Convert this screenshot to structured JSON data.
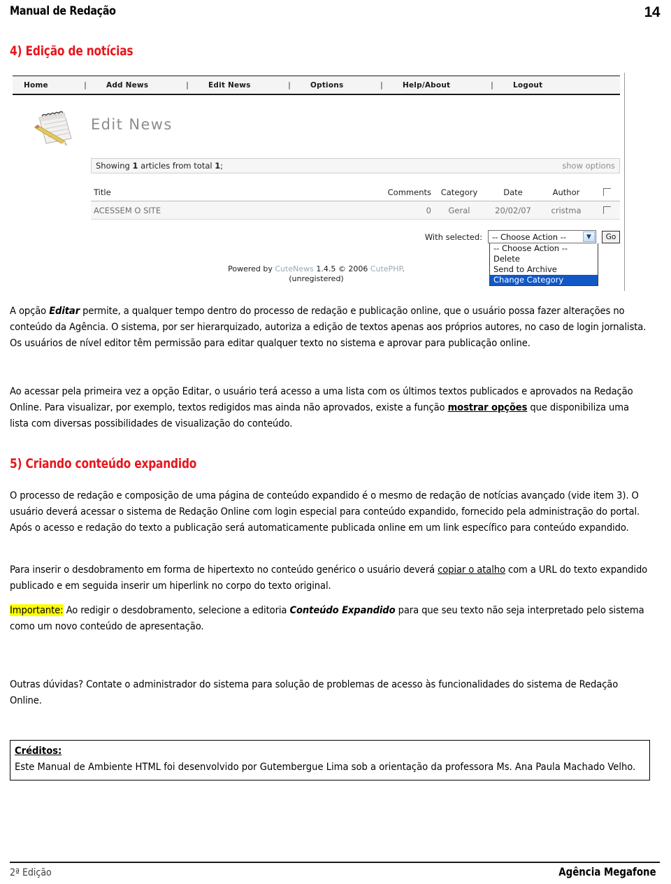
{
  "header": {
    "doc_title": "Manual de Redação",
    "page_number": "14"
  },
  "headings": {
    "section_4": "4) Edição de notícias",
    "section_5": "5) Criando conteúdo expandido"
  },
  "screenshot": {
    "app": "CuteNews",
    "nav": [
      {
        "label": "Home"
      },
      {
        "label": "Add News"
      },
      {
        "label": "Edit News"
      },
      {
        "label": "Options"
      },
      {
        "label": "Help/About"
      },
      {
        "label": "Logout"
      }
    ],
    "nav_separator": "|",
    "icon_name": "notepad-pencil-icon",
    "panel_title": "Edit News",
    "showing_prefix": "Showing",
    "showing_count": "1",
    "showing_middle": "articles from total",
    "showing_total": "1",
    "showing_suffix": ";",
    "show_options_link": "show options",
    "table": {
      "columns": [
        "Title",
        "Comments",
        "Category",
        "Date",
        "Author",
        ""
      ],
      "rows": [
        {
          "title": "ACESSEM O SITE",
          "comments": "0",
          "category": "Geral",
          "date": "20/02/07",
          "author": "cristma"
        }
      ]
    },
    "with_selected_label": "With selected:",
    "select_value": "-- Choose Action --",
    "select_options": [
      "-- Choose Action --",
      "Delete",
      "Send to Archive",
      "Change Category"
    ],
    "select_highlighted": "Change Category",
    "go_button": "Go",
    "footer_line1_pre": "Powered by ",
    "footer_link1": "CuteNews",
    "footer_version": " 1.4.5 © 2006 ",
    "footer_link2": "CutePHP",
    "footer_dot": ".",
    "footer_line2": "(unregistered)"
  },
  "paragraphs": {
    "p1_a": "A opção ",
    "p1_em": "Editar",
    "p1_b": " permite, a qualquer tempo dentro do processo de redação e publicação online, que o usuário possa fazer alterações no conteúdo da Agência. O sistema, por ser hierarquizado, autoriza a edição de textos apenas aos próprios autores, no caso de login jornalista. Os usuários de nível editor têm permissão para editar qualquer texto no sistema e aprovar para publicação online.",
    "p2_a": "Ao acessar pela primeira vez a opção Editar, o usuário terá acesso a uma lista com os últimos textos publicados e aprovados na Redação Online. Para visualizar, por exemplo, textos redigidos mas ainda não aprovados, existe a função ",
    "p2_strong": "mostrar opções",
    "p2_b": " que disponibiliza uma lista com diversas possibilidades de visualização do conteúdo.",
    "p3": "O processo de redação e composição de uma página de conteúdo expandido é o mesmo de redação de notícias avançado (vide item 3). O usuário deverá acessar o sistema de Redação Online com login especial para conteúdo expandido, fornecido pela administração do portal. Após o acesso e redação do texto a publicação será automaticamente publicada online em um link específico para conteúdo expandido.",
    "p4_a": "Para inserir o desdobramento em forma de hipertexto no conteúdo genérico o usuário deverá ",
    "p4_link": "copiar o atalho",
    "p4_b": " com a URL do texto expandido publicado e em seguida inserir um hiperlink no corpo do texto original.",
    "p5_highlight": "Importante:",
    "p5_a": " Ao redigir o desdobramento, selecione a editoria ",
    "p5_em": "Conteúdo Expandido",
    "p5_b": " para que seu texto não seja interpretado pelo sistema como um novo conteúdo de apresentação.",
    "p6": "Outras dúvidas? Contate o administrador do sistema para solução de problemas de acesso às funcionalidades do sistema de Redação Online."
  },
  "credits": {
    "label": "Créditos:",
    "text": "Este Manual de Ambiente HTML foi desenvolvido por Gutembergue Lima sob a orientação da professora Ms. Ana Paula Machado Velho."
  },
  "footer": {
    "edition": "2ª Edição",
    "organization": "Agência Megafone"
  },
  "colors": {
    "heading_red": "#e8151c",
    "highlight_yellow": "#ffff00",
    "select_highlight_blue": "#1158c6"
  }
}
